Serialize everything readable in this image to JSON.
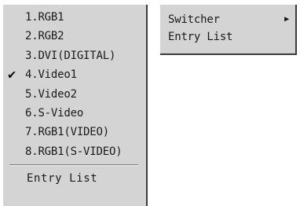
{
  "source_menu": {
    "items": [
      {
        "label": "1.RGB1",
        "checked": false
      },
      {
        "label": "2.RGB2",
        "checked": false
      },
      {
        "label": "3.DVI(DIGITAL)",
        "checked": false
      },
      {
        "label": "4.Video1",
        "checked": true
      },
      {
        "label": "5.Video2",
        "checked": false
      },
      {
        "label": "6.S-Video",
        "checked": false
      },
      {
        "label": "7.RGB1(VIDEO)",
        "checked": false
      },
      {
        "label": "8.RGB1(S-VIDEO)",
        "checked": false
      }
    ],
    "check_mark": "✔",
    "entry_list_label": "Entry List"
  },
  "sub_menu": {
    "switcher_label": "Switcher",
    "switcher_arrow": "▶",
    "entry_list_label": "Entry List"
  },
  "colors": {
    "menu_background": "#d4d4d4",
    "menu_shadow": "#3a3a3a",
    "text": "#1a1a1a"
  }
}
